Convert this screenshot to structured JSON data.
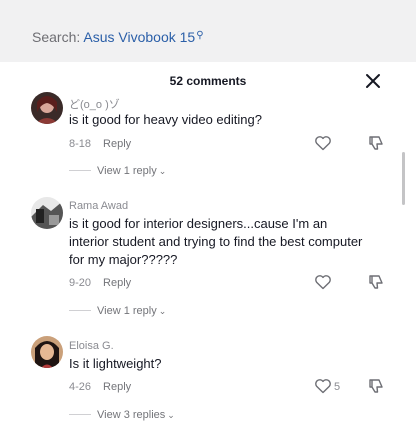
{
  "search": {
    "prefix": "Search: ",
    "query": "Asus Vivobook 15",
    "icon": "search-icon"
  },
  "header": {
    "count_label": "52 comments"
  },
  "comments": [
    {
      "user": "ど(o_o )ゾ",
      "text": "is it good for heavy video editing?",
      "date": "8-18",
      "reply_label": "Reply",
      "likes": "",
      "view_replies": "View 1 reply"
    },
    {
      "user": "Rama Awad",
      "text": "is it good for interior designers...cause I'm an interior student and trying to find the best computer for my major?????",
      "date": "9-20",
      "reply_label": "Reply",
      "likes": "",
      "view_replies": "View 1 reply"
    },
    {
      "user": "Eloisa G.",
      "text": "Is it lightweight?",
      "date": "4-26",
      "reply_label": "Reply",
      "likes": "5",
      "view_replies": "View 3 replies"
    }
  ],
  "colors": {
    "accent": "#2b5fa8",
    "text": "#161823",
    "muted": "#8a8b91",
    "top_bg": "#f1f1f2"
  }
}
